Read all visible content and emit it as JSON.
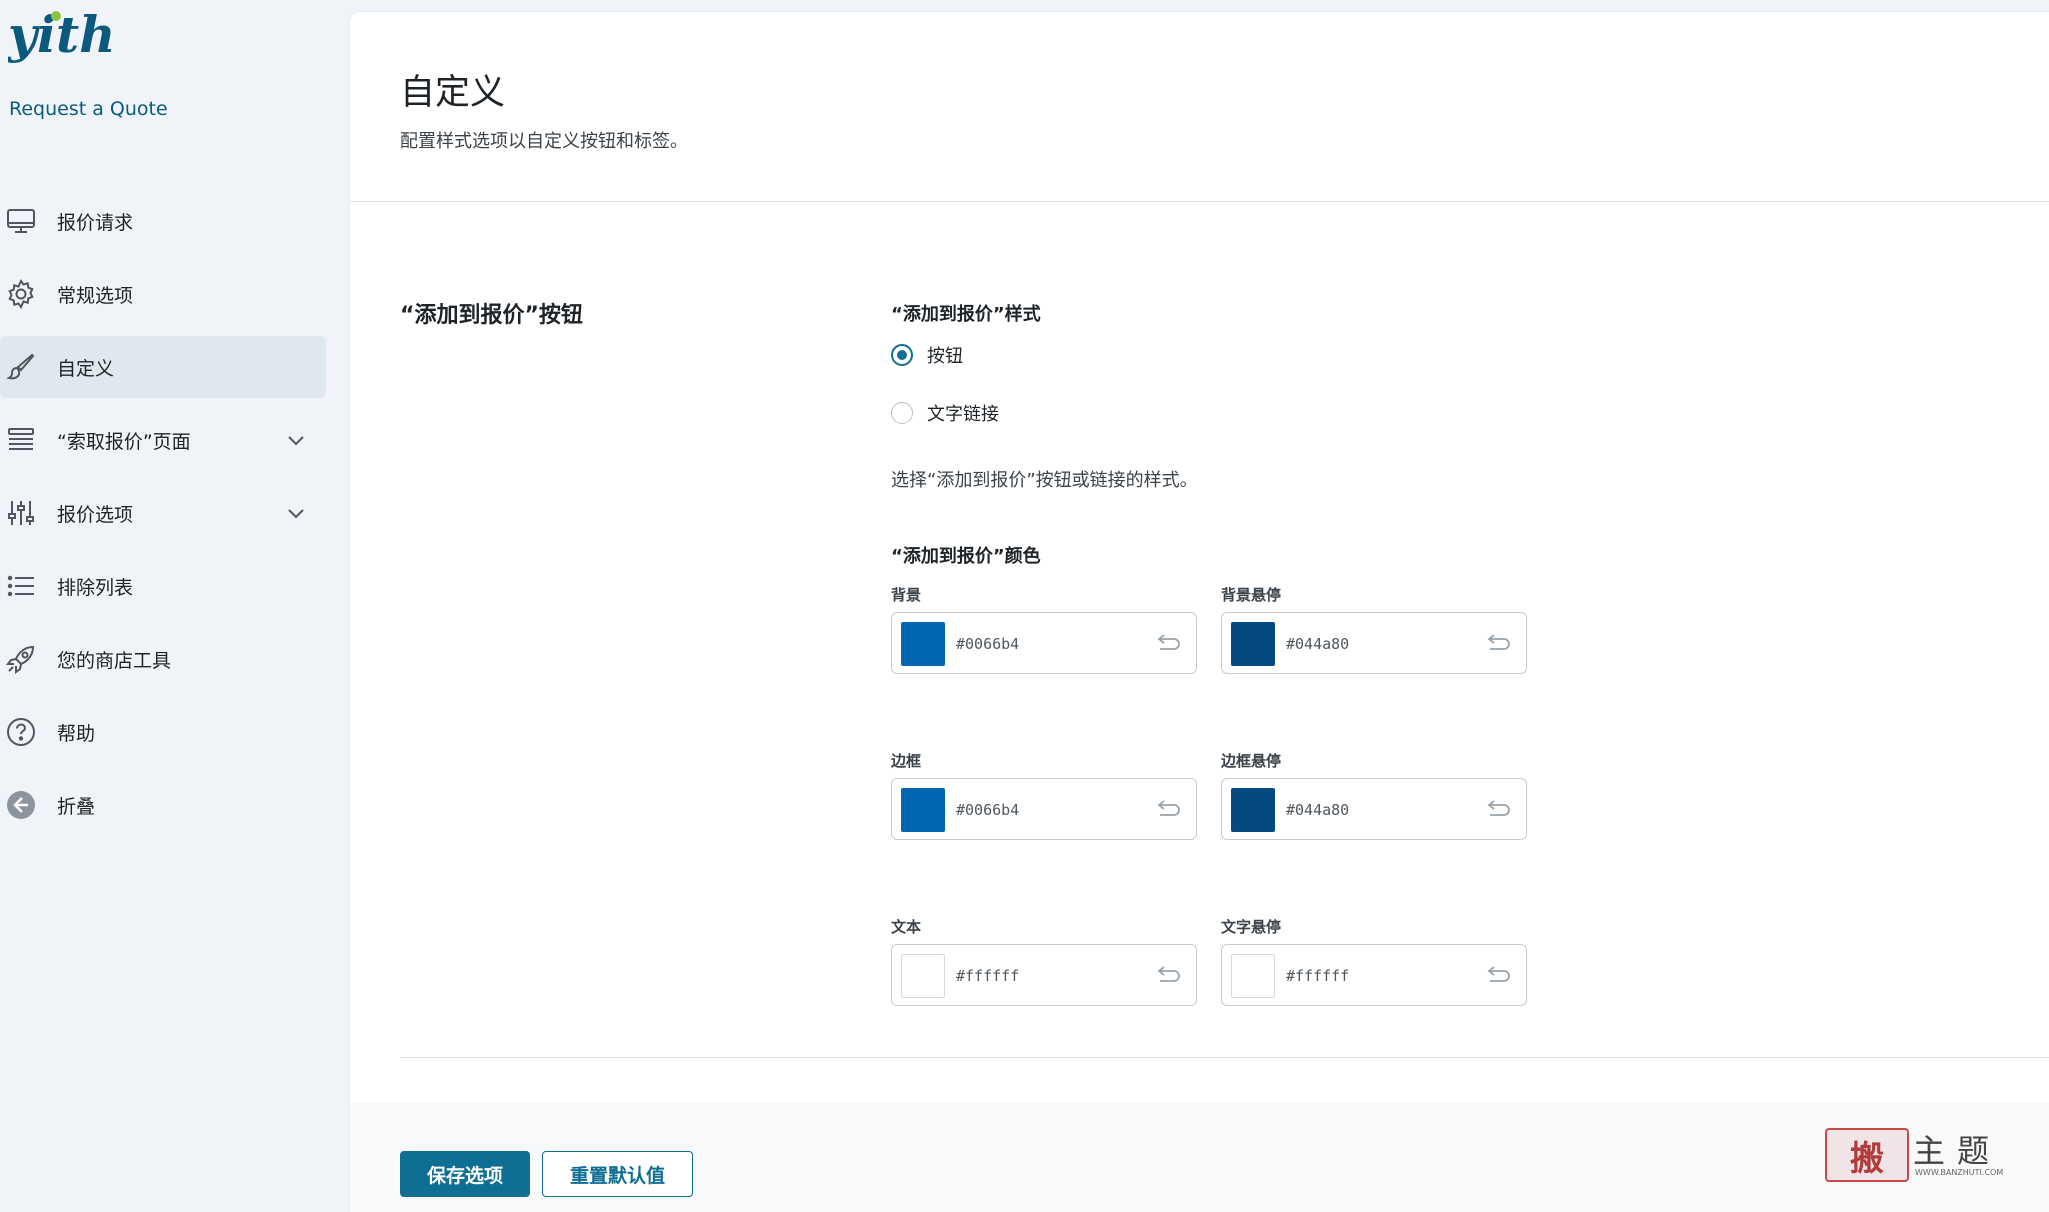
{
  "sidebar": {
    "logo_text": "yith",
    "plugin_name": "Request a Quote",
    "items": [
      {
        "label": "报价请求",
        "icon": "monitor-icon",
        "active": false,
        "expandable": false
      },
      {
        "label": "常规选项",
        "icon": "gear-icon",
        "active": false,
        "expandable": false
      },
      {
        "label": "自定义",
        "icon": "brush-icon",
        "active": true,
        "expandable": false
      },
      {
        "label": "“索取报价”页面",
        "icon": "layers-icon",
        "active": false,
        "expandable": true
      },
      {
        "label": "报价选项",
        "icon": "sliders-icon",
        "active": false,
        "expandable": true
      },
      {
        "label": "排除列表",
        "icon": "list-icon",
        "active": false,
        "expandable": false
      },
      {
        "label": "您的商店工具",
        "icon": "rocket-icon",
        "active": false,
        "expandable": false
      },
      {
        "label": "帮助",
        "icon": "help-icon",
        "active": false,
        "expandable": false
      },
      {
        "label": "折叠",
        "icon": "collapse-icon",
        "active": false,
        "expandable": false
      }
    ]
  },
  "page": {
    "title": "自定义",
    "description": "配置样式选项以自定义按钮和标签。"
  },
  "section": {
    "title": "“添加到报价”按钮",
    "style_label": "“添加到报价”样式",
    "style_options": [
      {
        "label": "按钮",
        "checked": true
      },
      {
        "label": "文字链接",
        "checked": false
      }
    ],
    "style_help": "选择“添加到报价”按钮或链接的样式。",
    "colors_label": "“添加到报价”颜色",
    "colors": [
      {
        "label": "背景",
        "value": "#0066b4"
      },
      {
        "label": "背景悬停",
        "value": "#044a80"
      },
      {
        "label": "边框",
        "value": "#0066b4"
      },
      {
        "label": "边框悬停",
        "value": "#044a80"
      },
      {
        "label": "文本",
        "value": "#ffffff"
      },
      {
        "label": "文字悬停",
        "value": "#ffffff"
      }
    ]
  },
  "footer": {
    "save_label": "保存选项",
    "reset_label": "重置默认值"
  },
  "watermark": {
    "seal": "搬",
    "text": "主题",
    "url": "WWW.BANZHUTI.COM"
  },
  "theme": {
    "accent": "#0e6e93",
    "logo_dot": "#8cc63f"
  }
}
